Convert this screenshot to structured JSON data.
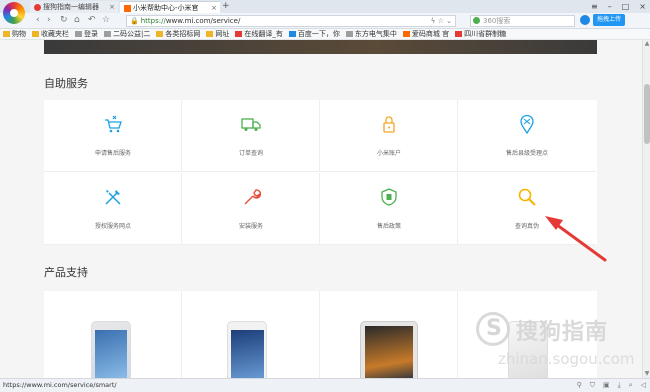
{
  "browser": {
    "tabs": [
      {
        "label": "搜狗指南一编辑器"
      },
      {
        "label": "小米帮助中心-小米官"
      }
    ],
    "new_tab": "+",
    "url_scheme": "https://",
    "url_rest": "www.mi.com/service/",
    "search_placeholder": "360搜索",
    "upload_label": "拖拽上传",
    "bookmarks": [
      {
        "label": "购物",
        "icon": "folder-icon"
      },
      {
        "label": "收藏夹栏",
        "icon": "folder-icon"
      },
      {
        "label": "登录",
        "icon": "link-icon"
      },
      {
        "label": "二码公益|二",
        "icon": "page-icon"
      },
      {
        "label": "各类招标网",
        "icon": "folder-icon"
      },
      {
        "label": "网址",
        "icon": "folder-icon"
      },
      {
        "label": "在线翻译_有",
        "icon": "youdao-icon"
      },
      {
        "label": "百度一下，你",
        "icon": "baidu-icon"
      },
      {
        "label": "东方电气集中",
        "icon": "page-icon"
      },
      {
        "label": "爱码商城 官",
        "icon": "mi-icon"
      },
      {
        "label": "四川省群制糖",
        "icon": "page-icon"
      }
    ],
    "status_url": "https://www.mi.com/service/smart/"
  },
  "page": {
    "self_service_title": "自助服务",
    "services": [
      {
        "label": "申请售后服务",
        "icon": "cart-wrench-icon"
      },
      {
        "label": "订单查询",
        "icon": "truck-icon"
      },
      {
        "label": "小米账户",
        "icon": "lock-icon"
      },
      {
        "label": "售后县级受理点",
        "icon": "map-pin-icon"
      },
      {
        "label": "授权服务网点",
        "icon": "tools-icon"
      },
      {
        "label": "安装服务",
        "icon": "wrench-icon"
      },
      {
        "label": "售后政策",
        "icon": "shield-icon"
      },
      {
        "label": "查询真伪",
        "icon": "magnifier-icon"
      }
    ],
    "product_support_title": "产品支持"
  },
  "watermark": {
    "brand": "搜狗指南",
    "url": "zhinan.sogou.com"
  },
  "colors": {
    "accent_blue": "#1aa0e6",
    "accent_green": "#4caf50",
    "accent_orange": "#f5a623",
    "accent_red": "#e74c3c",
    "accent_yellow": "#f5b400",
    "arrow_red": "#e53935"
  }
}
